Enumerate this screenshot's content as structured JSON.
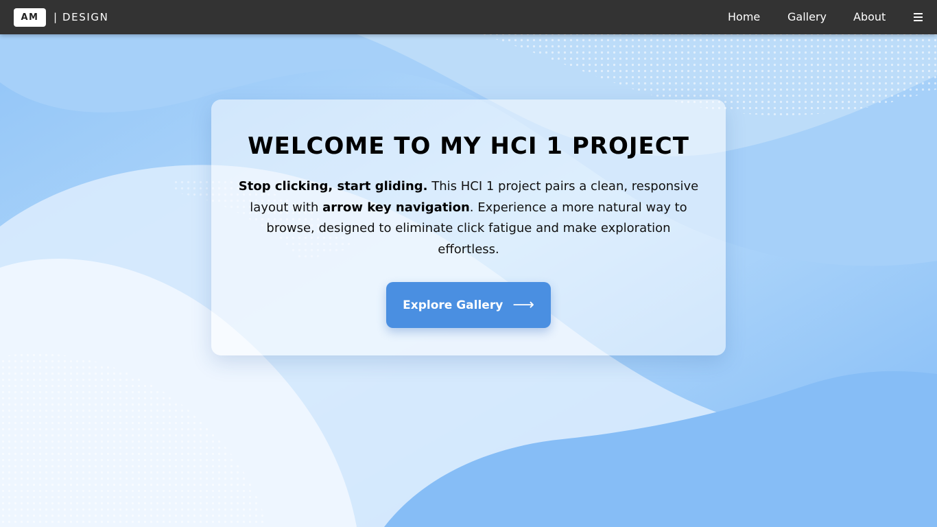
{
  "header": {
    "logo_badge": "AM",
    "logo_text": "| DESIGN",
    "nav": {
      "home": "Home",
      "gallery": "Gallery",
      "about": "About"
    },
    "menu_icon": "hamburger-menu-icon"
  },
  "hero": {
    "title": "WELCOME TO MY HCI 1 PROJECT",
    "text": {
      "lead_bold": "Stop clicking, start gliding.",
      "part1": " This HCI 1 project pairs a clean, responsive layout with ",
      "mid_bold": "arrow key navigation",
      "part2": ". Experience a more natural way to browse, designed to eliminate click fatigue and make exploration effortless."
    },
    "button_label": "Explore Gallery",
    "button_icon": "long-right-arrow-icon",
    "button_arrow": "⟶"
  },
  "colors": {
    "navbar": "#333333",
    "accent": "#4a8fe1",
    "background": "#9ccaf8"
  }
}
